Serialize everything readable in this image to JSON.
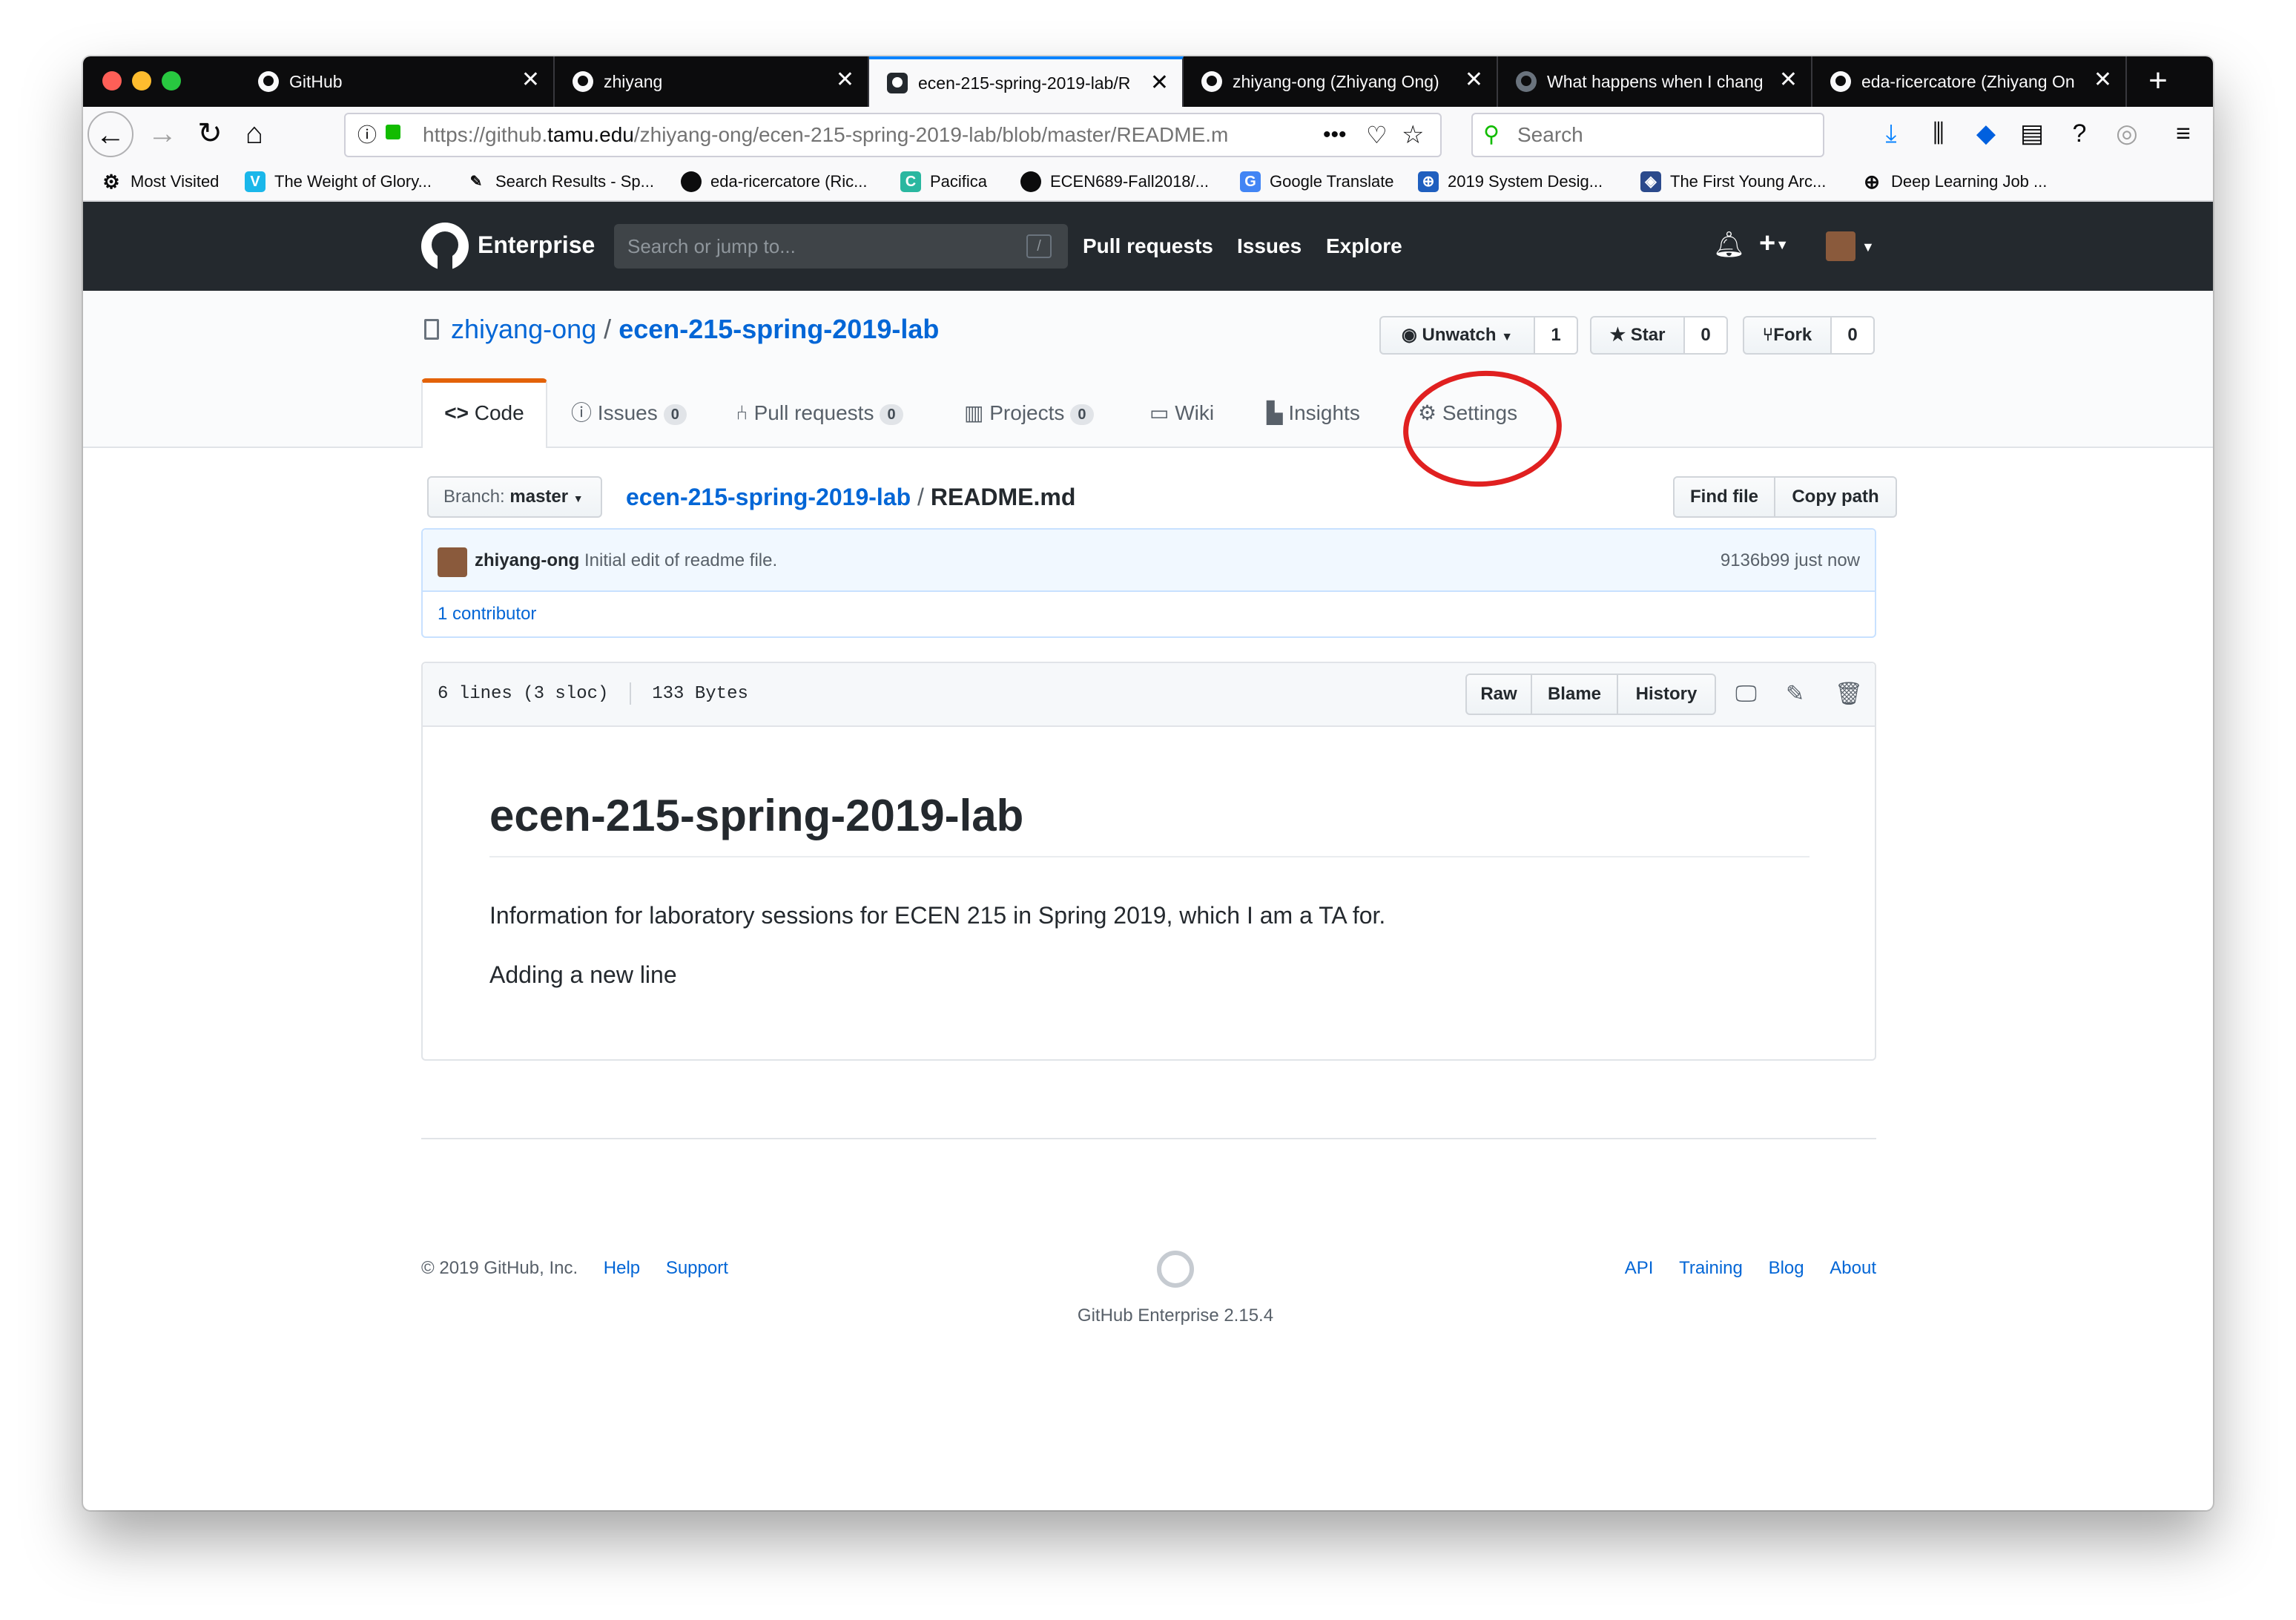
{
  "browser": {
    "tabs": [
      {
        "label": "GitHub"
      },
      {
        "label": "zhiyang"
      },
      {
        "label": "ecen-215-spring-2019-lab/R"
      },
      {
        "label": "zhiyang-ong (Zhiyang Ong)"
      },
      {
        "label": "What happens when I chang"
      },
      {
        "label": "eda-ricercatore (Zhiyang On"
      }
    ],
    "url_prefix": "https://github.",
    "url_domain": "tamu.edu",
    "url_path": "/zhiyang-ong/ecen-215-spring-2019-lab/blob/master/README.m",
    "search_placeholder": "Search",
    "bookmarks": [
      {
        "label": "Most Visited"
      },
      {
        "label": "The Weight of Glory..."
      },
      {
        "label": "Search Results - Sp..."
      },
      {
        "label": "eda-ricercatore (Ric..."
      },
      {
        "label": "Pacifica"
      },
      {
        "label": "ECEN689-Fall2018/..."
      },
      {
        "label": "Google Translate"
      },
      {
        "label": "2019 System Desig..."
      },
      {
        "label": "The First Young Arc..."
      },
      {
        "label": "Deep Learning Job ..."
      }
    ]
  },
  "header": {
    "brand": "Enterprise",
    "search_placeholder": "Search or jump to...",
    "search_key": "/",
    "nav": [
      "Pull requests",
      "Issues",
      "Explore"
    ]
  },
  "repo": {
    "owner": "zhiyang-ong",
    "separator": "/",
    "name": "ecen-215-spring-2019-lab",
    "watch_label": "Unwatch",
    "watch_count": "1",
    "star_label": "Star",
    "star_count": "0",
    "fork_label": "Fork",
    "fork_count": "0",
    "tabs": {
      "code": "Code",
      "issues": "Issues",
      "issues_count": "0",
      "pulls": "Pull requests",
      "pulls_count": "0",
      "projects": "Projects",
      "projects_count": "0",
      "wiki": "Wiki",
      "insights": "Insights",
      "settings": "Settings"
    }
  },
  "file": {
    "branch_label": "Branch:",
    "branch": "master",
    "repo_link": "ecen-215-spring-2019-lab",
    "path_sep": "/",
    "filename": "README.md",
    "find_file": "Find file",
    "copy_path": "Copy path",
    "commit_author": "zhiyang-ong",
    "commit_message": "Initial edit of readme file.",
    "commit_sha": "9136b99",
    "commit_time": "just now",
    "contributors": "1 contributor",
    "lines": "6 lines (3 sloc)",
    "size": "133 Bytes",
    "raw": "Raw",
    "blame": "Blame",
    "history": "History"
  },
  "readme": {
    "heading": "ecen-215-spring-2019-lab",
    "p1": "Information for laboratory sessions for ECEN 215 in Spring 2019, which I am a TA for.",
    "p2": "Adding a new line"
  },
  "footer": {
    "copyright": "© 2019 GitHub, Inc.",
    "help": "Help",
    "support": "Support",
    "api": "API",
    "training": "Training",
    "blog": "Blog",
    "about": "About",
    "version": "GitHub Enterprise 2.15.4"
  },
  "colors": {
    "annotation": "#e02020",
    "link": "#0366d6",
    "header_bg": "#24292e"
  }
}
